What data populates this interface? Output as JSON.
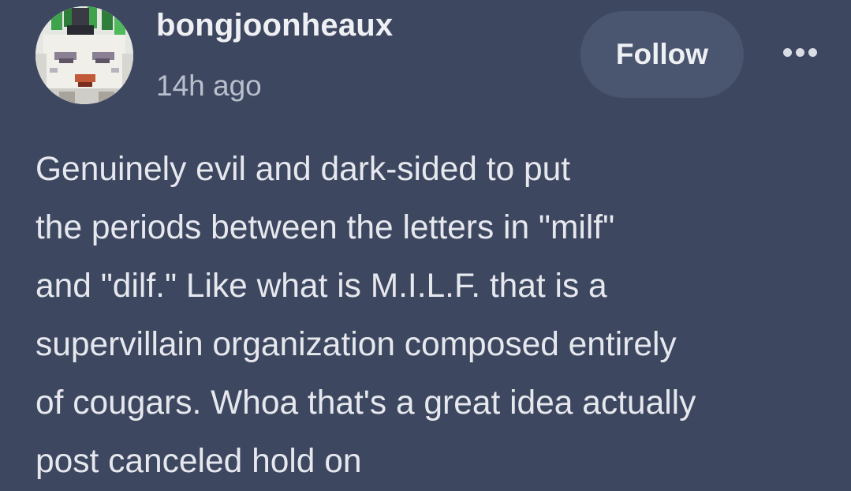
{
  "post": {
    "author": {
      "username": "bongjoonheaux",
      "avatar_icon": "pixel-art-face-avatar"
    },
    "timestamp": "14h ago",
    "follow_label": "Follow",
    "more_icon": "ellipsis-icon",
    "body_lines": [
      "Genuinely evil and dark-sided to put",
      "the periods between the letters in \"milf\"",
      "and \"dilf.\" Like what is M.I.L.F. that is a",
      "supervillain organization composed entirely",
      "of cougars. Whoa that's a great idea actually",
      "post canceled hold on"
    ]
  },
  "colors": {
    "background": "#3d4760",
    "follow_button_bg": "#4a5570",
    "text_primary": "#e6e8ee",
    "text_secondary": "#b9bfcc"
  }
}
